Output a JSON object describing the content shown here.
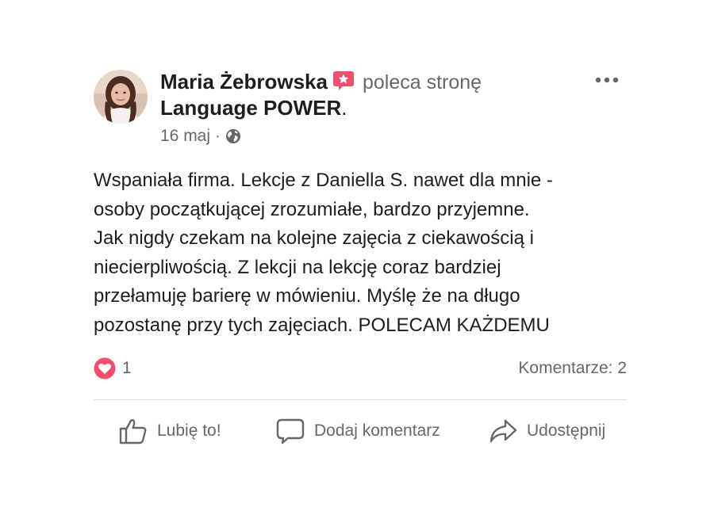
{
  "post": {
    "author": "Maria Żebrowska",
    "action": "poleca stronę",
    "page_name": "Language POWER",
    "page_suffix": ".",
    "date": "16 maj",
    "separator": "·",
    "icons": {
      "recommendation": "recommendation-star-icon",
      "audience": "globe-icon",
      "menu": "more-options-icon",
      "reaction": "love-reaction-icon"
    },
    "colors": {
      "recommendation_badge": "#f0506e",
      "love_reaction": "#f0506e",
      "secondary_text": "#65676b",
      "primary_text": "#1c1e21"
    },
    "body_lines": [
      "Wspaniała firma. Lekcje z Daniella S. nawet dla mnie -",
      "osoby początkującej zrozumiałe, bardzo przyjemne.",
      "Jak nigdy czekam na kolejne zajęcia z ciekawością i",
      "niecierpliwością. Z lekcji na lekcję coraz bardziej",
      "przełamuję barierę w mówieniu. Myślę że na długo",
      "pozostanę przy tych zajęciach. POLECAM KAŻDEMU"
    ],
    "reaction_count": "1",
    "comments_label": "Komentarze: 2",
    "actions": {
      "like": "Lubię to!",
      "comment": "Dodaj komentarz",
      "share": "Udostępnij"
    }
  }
}
